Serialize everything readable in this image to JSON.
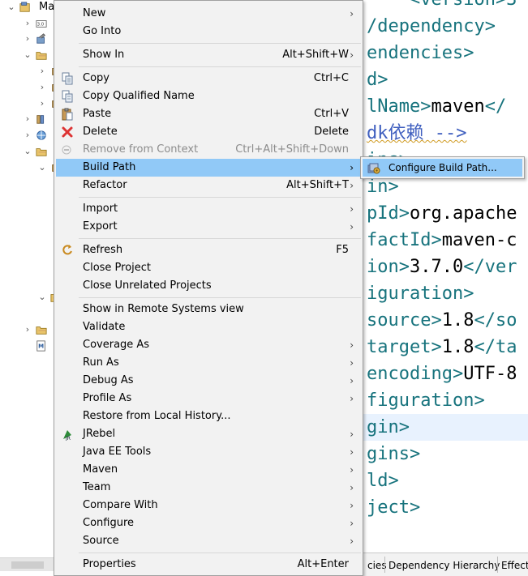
{
  "explorer": {
    "root_label": "Ma",
    "rows": [
      {
        "chevron": "expanded",
        "icon": "project-icon"
      },
      {
        "chevron": "collapsed",
        "icon": "jre-library-icon"
      },
      {
        "chevron": "collapsed",
        "icon": "maven-deps-icon"
      },
      {
        "chevron": "expanded",
        "icon": "folder-icon"
      },
      {
        "chevron": "collapsed",
        "icon": "package-icon"
      },
      {
        "chevron": "collapsed",
        "icon": "package-icon"
      },
      {
        "chevron": "collapsed",
        "icon": "package-icon"
      },
      {
        "chevron": "collapsed",
        "icon": "library-icon"
      },
      {
        "chevron": "collapsed",
        "icon": "web-resources-icon"
      },
      {
        "chevron": "expanded",
        "icon": "folder-icon"
      },
      {
        "chevron": "expanded",
        "icon": "package-icon"
      },
      {
        "chevron": "expanded",
        "icon": "folder-icon"
      },
      {
        "chevron": "collapsed",
        "icon": "folder-icon"
      },
      {
        "chevron": "none",
        "icon": "maven-pom-icon"
      }
    ]
  },
  "editor": {
    "lines": [
      {
        "parts": [
          {
            "t": "tag",
            "s": "    <version>3"
          }
        ]
      },
      {
        "parts": [
          {
            "t": "tag",
            "s": "/dependency>"
          }
        ]
      },
      {
        "parts": [
          {
            "t": "tag",
            "s": "endencies>"
          }
        ]
      },
      {
        "parts": [
          {
            "t": "tag",
            "s": "d>"
          }
        ]
      },
      {
        "parts": [
          {
            "t": "tag",
            "s": "lName>"
          },
          {
            "t": "txt",
            "s": "maven"
          },
          {
            "t": "tag",
            "s": "</"
          }
        ]
      },
      {
        "parts": [
          {
            "t": "cmt",
            "s": "dk依赖 -->"
          }
        ]
      },
      {
        "parts": [
          {
            "t": "tag",
            "s": "ins>"
          }
        ]
      },
      {
        "parts": [
          {
            "t": "tag",
            "s": "in>"
          }
        ]
      },
      {
        "parts": [
          {
            "t": "tag",
            "s": "pId>"
          },
          {
            "t": "txt",
            "s": "org.apache"
          }
        ]
      },
      {
        "parts": [
          {
            "t": "tag",
            "s": "factId>"
          },
          {
            "t": "txt",
            "s": "maven-c"
          }
        ]
      },
      {
        "parts": [
          {
            "t": "tag",
            "s": "ion>"
          },
          {
            "t": "txt",
            "s": "3.7.0"
          },
          {
            "t": "tag",
            "s": "</ver"
          }
        ]
      },
      {
        "parts": [
          {
            "t": "tag",
            "s": "iguration>"
          }
        ]
      },
      {
        "parts": [
          {
            "t": "tag",
            "s": "source>"
          },
          {
            "t": "txt",
            "s": "1.8"
          },
          {
            "t": "tag",
            "s": "</so"
          }
        ]
      },
      {
        "parts": [
          {
            "t": "tag",
            "s": "target>"
          },
          {
            "t": "txt",
            "s": "1.8"
          },
          {
            "t": "tag",
            "s": "</ta"
          }
        ]
      },
      {
        "parts": [
          {
            "t": "tag",
            "s": "encoding>"
          },
          {
            "t": "txt",
            "s": "UTF-8"
          }
        ]
      },
      {
        "parts": [
          {
            "t": "tag",
            "s": "figuration>"
          }
        ]
      },
      {
        "parts": [
          {
            "t": "tag",
            "s": "gin>"
          }
        ],
        "highlight": true
      },
      {
        "parts": [
          {
            "t": "tag",
            "s": "gins>"
          }
        ]
      },
      {
        "parts": [
          {
            "t": "tag",
            "s": "ld>"
          }
        ]
      },
      {
        "parts": [
          {
            "t": "tag",
            "s": "ject>"
          }
        ]
      }
    ]
  },
  "bottom_tabs": [
    {
      "label": "cies"
    },
    {
      "label": "Dependency Hierarchy"
    },
    {
      "label": "Effecti"
    }
  ],
  "context_menu": {
    "items": [
      {
        "label": "New",
        "submenu": true
      },
      {
        "label": "Go Into"
      },
      {
        "sep": true
      },
      {
        "label": "Show In",
        "shortcut": "Alt+Shift+W",
        "submenu": true
      },
      {
        "sep": true
      },
      {
        "label": "Copy",
        "shortcut": "Ctrl+C",
        "icon": "copy-icon"
      },
      {
        "label": "Copy Qualified Name",
        "icon": "copy-qualified-name-icon"
      },
      {
        "label": "Paste",
        "shortcut": "Ctrl+V",
        "icon": "paste-icon"
      },
      {
        "label": "Delete",
        "shortcut": "Delete",
        "icon": "delete-icon"
      },
      {
        "label": "Remove from Context",
        "shortcut": "Ctrl+Alt+Shift+Down",
        "icon": "remove-from-context-icon",
        "disabled": true
      },
      {
        "label": "Build Path",
        "submenu": true,
        "hover": true
      },
      {
        "label": "Refactor",
        "shortcut": "Alt+Shift+T",
        "submenu": true
      },
      {
        "sep": true
      },
      {
        "label": "Import",
        "submenu": true
      },
      {
        "label": "Export",
        "submenu": true
      },
      {
        "sep": true
      },
      {
        "label": "Refresh",
        "shortcut": "F5",
        "icon": "refresh-icon"
      },
      {
        "label": "Close Project"
      },
      {
        "label": "Close Unrelated Projects"
      },
      {
        "sep": true
      },
      {
        "label": "Show in Remote Systems view"
      },
      {
        "label": "Validate"
      },
      {
        "label": "Coverage As",
        "submenu": true
      },
      {
        "label": "Run As",
        "submenu": true
      },
      {
        "label": "Debug As",
        "submenu": true
      },
      {
        "label": "Profile As",
        "submenu": true
      },
      {
        "label": "Restore from Local History..."
      },
      {
        "label": "JRebel",
        "submenu": true,
        "icon": "jrebel-icon"
      },
      {
        "label": "Java EE Tools",
        "submenu": true
      },
      {
        "label": "Maven",
        "submenu": true
      },
      {
        "label": "Team",
        "submenu": true
      },
      {
        "label": "Compare With",
        "submenu": true
      },
      {
        "label": "Configure",
        "submenu": true
      },
      {
        "label": "Source",
        "submenu": true
      },
      {
        "sep": true
      },
      {
        "label": "Properties",
        "shortcut": "Alt+Enter"
      }
    ]
  },
  "submenu": {
    "label": "Configure Build Path...",
    "icon": "configure-build-path-icon"
  },
  "colors": {
    "menu_bg": "#f2f2f2",
    "hover_bg": "#91c9f7",
    "xml_tag": "#17737d",
    "comment": "#3f5fbf",
    "line_highlight": "#e8f2fe"
  }
}
